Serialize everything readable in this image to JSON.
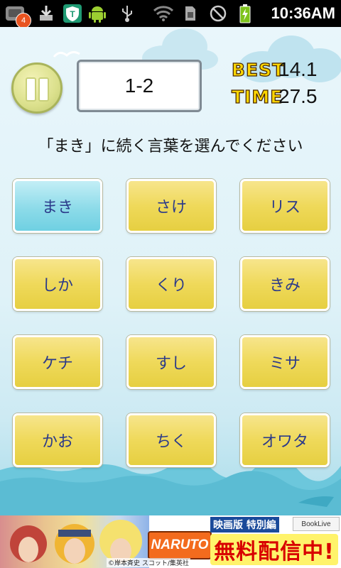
{
  "status_bar": {
    "notification_count": "4",
    "time": "10:36AM",
    "icons": [
      "notification-icon",
      "download-icon",
      "shield-app-icon",
      "android-icon",
      "usb-icon",
      "wifi-icon",
      "sd-card-icon",
      "no-signal-icon",
      "battery-charging-icon"
    ]
  },
  "game": {
    "stage": "1-2",
    "best_label": "BEST",
    "best_value": "14.1",
    "time_label": "TIME",
    "time_value": "27.5",
    "prompt": "「まき」に続く言葉を選んでください",
    "answers": [
      "まき",
      "さけ",
      "リス",
      "しか",
      "くり",
      "きみ",
      "ケチ",
      "すし",
      "ミサ",
      "かお",
      "ちく",
      "オワタ"
    ],
    "selected_index": 0,
    "colors": {
      "answer_yellow": "#efd95a",
      "answer_selected": "#8ddbe9",
      "answer_text": "#2b3a8a",
      "sky": "#dff2f8",
      "sea": "#6cc7dc"
    }
  },
  "ad": {
    "logo": "NARUTO",
    "sub_label": "映画版 特別編",
    "store": "BookLive",
    "headline": "無料配信中!",
    "copyright": "©岸本斉史 スコット/集英社"
  }
}
